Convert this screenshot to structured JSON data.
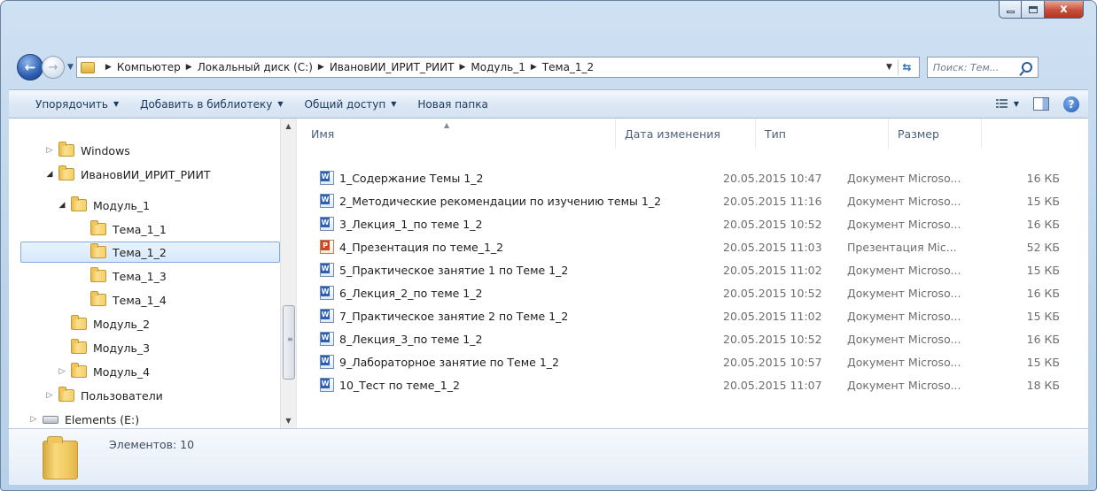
{
  "window": {
    "close_glyph": "x"
  },
  "address": {
    "breadcrumbs": [
      "Компьютер",
      "Локальный диск (C:)",
      "ИвановИИ_ИРИТ_РИИТ",
      "Модуль_1",
      "Тема_1_2"
    ]
  },
  "search": {
    "placeholder": "Поиск: Тем..."
  },
  "toolbar": {
    "organize": "Упорядочить",
    "add_to_library": "Добавить в библиотеку",
    "share": "Общий доступ",
    "new_folder": "Новая папка"
  },
  "nav_tree": [
    {
      "label": "Windows",
      "expand": "▷",
      "icon": "folder",
      "indent": 0
    },
    {
      "label": "ИвановИИ_ИРИТ_РИИТ",
      "expand": "◢",
      "icon": "folder",
      "indent": 0
    },
    {
      "label": "Модуль_1",
      "expand": "◢",
      "icon": "folder",
      "indent": 1
    },
    {
      "label": "Тема_1_1",
      "expand": "",
      "icon": "folder",
      "indent": 2
    },
    {
      "label": "Тема_1_2",
      "expand": "",
      "icon": "folder",
      "indent": 2,
      "selected": true
    },
    {
      "label": "Тема_1_3",
      "expand": "",
      "icon": "folder",
      "indent": 2
    },
    {
      "label": "Тема_1_4",
      "expand": "",
      "icon": "folder",
      "indent": 2
    },
    {
      "label": "Модуль_2",
      "expand": "",
      "icon": "folder",
      "indent": 1
    },
    {
      "label": "Модуль_3",
      "expand": "",
      "icon": "folder",
      "indent": 1
    },
    {
      "label": "Модуль_4",
      "expand": "▷",
      "icon": "folder",
      "indent": 1
    },
    {
      "label": "Пользователи",
      "expand": "▷",
      "icon": "folder",
      "indent": 0
    },
    {
      "label": "Elements (E:)",
      "expand": "▷",
      "icon": "drive",
      "indent": -1
    }
  ],
  "columns": {
    "name": "Имя",
    "date": "Дата изменения",
    "type": "Тип",
    "size": "Размер"
  },
  "files": [
    {
      "name": "1_Содержание Темы 1_2",
      "date": "20.05.2015 10:47",
      "type": "Документ Microso...",
      "size": "16 КБ",
      "icon": "word"
    },
    {
      "name": "2_Методические рекомендации по изучению темы 1_2",
      "date": "20.05.2015 11:16",
      "type": "Документ Microso...",
      "size": "15 КБ",
      "icon": "word"
    },
    {
      "name": "3_Лекция_1_по теме 1_2",
      "date": "20.05.2015 10:52",
      "type": "Документ Microso...",
      "size": "16 КБ",
      "icon": "word"
    },
    {
      "name": "4_Презентация по теме_1_2",
      "date": "20.05.2015 11:03",
      "type": "Презентация Mic...",
      "size": "52 КБ",
      "icon": "powerpoint"
    },
    {
      "name": "5_Практическое занятие 1 по Теме 1_2",
      "date": "20.05.2015 11:02",
      "type": "Документ Microso...",
      "size": "15 КБ",
      "icon": "word"
    },
    {
      "name": "6_Лекция_2_по теме 1_2",
      "date": "20.05.2015 10:52",
      "type": "Документ Microso...",
      "size": "16 КБ",
      "icon": "word"
    },
    {
      "name": "7_Практическое занятие 2 по Теме 1_2",
      "date": "20.05.2015 11:02",
      "type": "Документ Microso...",
      "size": "15 КБ",
      "icon": "word"
    },
    {
      "name": "8_Лекция_3_по теме 1_2",
      "date": "20.05.2015 10:52",
      "type": "Документ Microso...",
      "size": "16 КБ",
      "icon": "word"
    },
    {
      "name": "9_Лабораторное занятие по Теме 1_2",
      "date": "20.05.2015 10:57",
      "type": "Документ Microso...",
      "size": "15 КБ",
      "icon": "word"
    },
    {
      "name": "10_Тест по теме_1_2",
      "date": "20.05.2015 11:07",
      "type": "Документ Microso...",
      "size": "18 КБ",
      "icon": "word"
    }
  ],
  "status": {
    "item_count": "Элементов: 10"
  }
}
